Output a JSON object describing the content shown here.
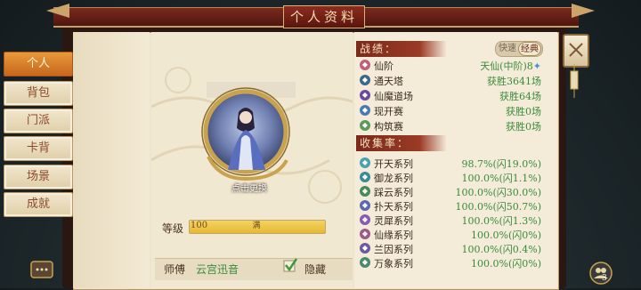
{
  "window": {
    "title": "个人资料"
  },
  "sidebar": {
    "items": [
      {
        "label": "个人",
        "active": true
      },
      {
        "label": "背包",
        "active": false
      },
      {
        "label": "门派",
        "active": false
      },
      {
        "label": "卡背",
        "active": false
      },
      {
        "label": "场景",
        "active": false
      },
      {
        "label": "成就",
        "active": false
      }
    ]
  },
  "profile": {
    "avatar_caption": "点击更换",
    "level_label": "等级",
    "level_value": "100",
    "level_status": "满",
    "level_fill_ratio": 1.0,
    "master_label": "师傅",
    "master_name": "云宫迅音",
    "hide_label": "隐藏",
    "hide_checked": true
  },
  "record": {
    "heading": "战绩：",
    "toggle": {
      "off_label": "快速",
      "on_label": "经典"
    },
    "rows": [
      {
        "name": "仙阶",
        "value": "天仙(中阶)8",
        "icon": "rank-icon",
        "color": "#c0607a",
        "star": true
      },
      {
        "name": "通天塔",
        "value": "获胜3641场",
        "icon": "tower-icon",
        "color": "#3a6a8a"
      },
      {
        "name": "仙魔道场",
        "value": "获胜64场",
        "icon": "arena-icon",
        "color": "#6a4a9a"
      },
      {
        "name": "现开赛",
        "value": "获胜0场",
        "icon": "draft-icon",
        "color": "#4a7ab0"
      },
      {
        "name": "构筑赛",
        "value": "获胜0场",
        "icon": "build-icon",
        "color": "#5a9a5a"
      }
    ]
  },
  "collection": {
    "heading": "收集率：",
    "rows": [
      {
        "name": "开天系列",
        "value": "98.7%(闪19.0%)",
        "icon": "series-icon",
        "color": "#4aa0b0"
      },
      {
        "name": "御龙系列",
        "value": "100.0%(闪1.1%)",
        "icon": "series-icon",
        "color": "#3a8a9a"
      },
      {
        "name": "踩云系列",
        "value": "100.0%(闪30.0%)",
        "icon": "series-icon",
        "color": "#4a8a5a"
      },
      {
        "name": "扑天系列",
        "value": "100.0%(闪50.7%)",
        "icon": "series-icon",
        "color": "#5a6ab0"
      },
      {
        "name": "灵犀系列",
        "value": "100.0%(闪1.3%)",
        "icon": "series-icon",
        "color": "#8a5ab0"
      },
      {
        "name": "仙缘系列",
        "value": "100.0%(闪0%)",
        "icon": "series-icon",
        "color": "#9a5a8a"
      },
      {
        "name": "兰因系列",
        "value": "100.0%(闪0.4%)",
        "icon": "series-icon",
        "color": "#6a5aa0"
      },
      {
        "name": "万象系列",
        "value": "100.0%(闪0%)",
        "icon": "series-icon",
        "color": "#4a8a6a"
      }
    ]
  },
  "corner": {
    "badge": "3"
  },
  "colors": {
    "accent": "#c8661d",
    "win_green": "#3a8a3a",
    "header_red": "#7a2a1c"
  }
}
